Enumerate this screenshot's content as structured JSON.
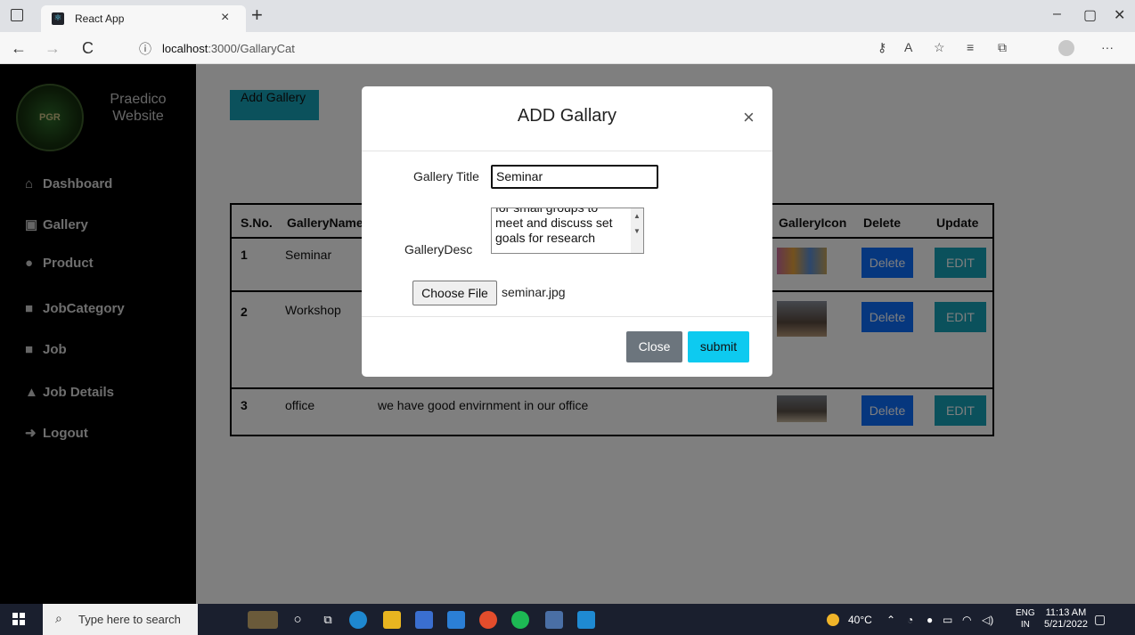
{
  "browser": {
    "tab_title": "React App",
    "tab_close": "×",
    "new_tab": "+",
    "url_host": "localhost",
    "url_rest": ":3000/GallaryCat",
    "back": "←",
    "forward": "→",
    "refresh": "C",
    "info": "ⓘ",
    "more": "···",
    "minimize": "–",
    "restore": "▢",
    "close": "✕"
  },
  "sidebar": {
    "brand": "Praedico Website",
    "logo_text": "PGR",
    "items": [
      {
        "label": "Dashboard",
        "icon": "⌂"
      },
      {
        "label": "Gallery",
        "icon": "▣"
      },
      {
        "label": "Product",
        "icon": "●"
      },
      {
        "label": "JobCategory",
        "icon": "■"
      },
      {
        "label": "Job",
        "icon": "■"
      },
      {
        "label": "Job Details",
        "icon": "▲"
      },
      {
        "label": "Logout",
        "icon": "➜"
      }
    ]
  },
  "main": {
    "add_button": "Add Gallery",
    "columns": [
      "S.No.",
      "GalleryName",
      "GalleryIcon",
      "Delete",
      "Update"
    ],
    "rows": [
      {
        "sno": "1",
        "name": "Seminar",
        "desc": "",
        "delete": "Delete",
        "edit": "EDIT"
      },
      {
        "sno": "2",
        "name": "Workshop",
        "desc": "",
        "delete": "Delete",
        "edit": "EDIT"
      },
      {
        "sno": "3",
        "name": "office",
        "desc": "we have good envirnment in our office",
        "delete": "Delete",
        "edit": "EDIT"
      }
    ]
  },
  "modal": {
    "title": "ADD Gallary",
    "close_x": "×",
    "title_label": "Gallery Title",
    "title_value": "Seminar",
    "desc_label": "GalleryDesc",
    "desc_lines": [
      "for small groups to",
      "meet and discuss set",
      "goals for research"
    ],
    "choose_file": "Choose File",
    "file_name": "seminar.jpg",
    "close_button": "Close",
    "submit_button": "submit"
  },
  "taskbar": {
    "search_placeholder": "Type here to search",
    "temperature": "40°C",
    "lang_1": "ENG",
    "lang_2": "IN",
    "time": "11:13 AM",
    "date": "5/21/2022"
  }
}
